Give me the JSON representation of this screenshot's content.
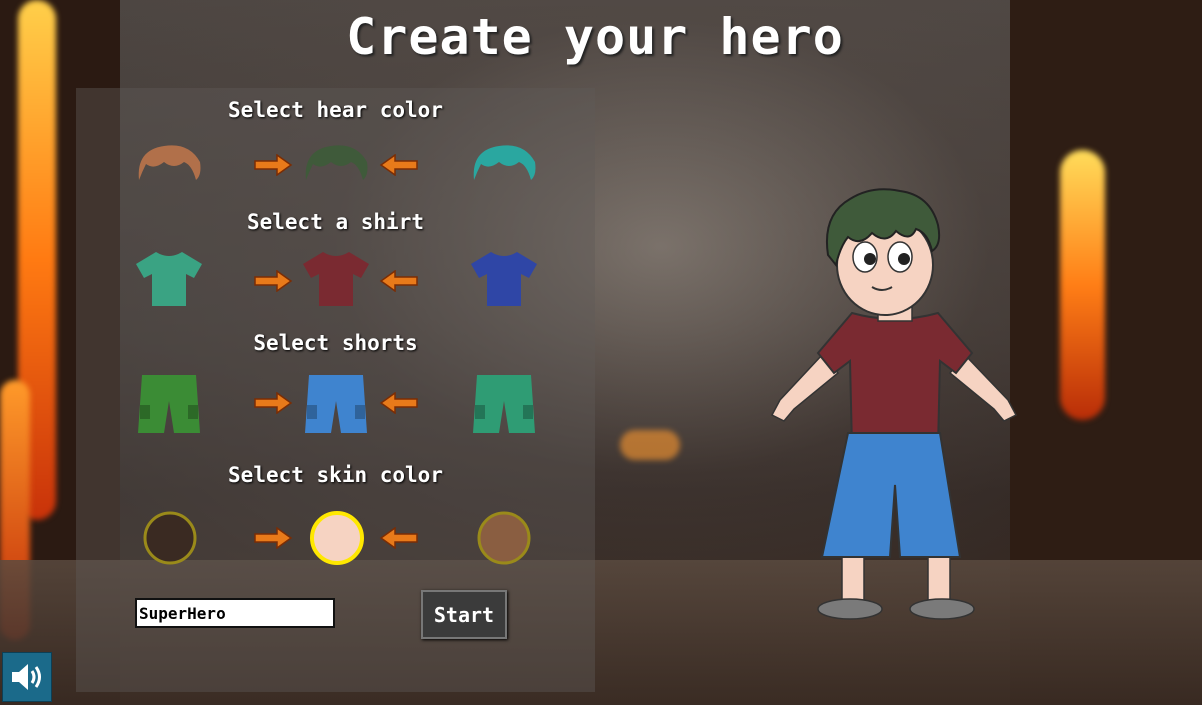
{
  "title": "Create your hero",
  "sections": {
    "hair": {
      "label": "Select hear color",
      "colors": [
        "#b1704a",
        "#3f5a3a",
        "#2aa7a0"
      ]
    },
    "shirt": {
      "label": "Select a shirt",
      "colors": [
        "#3aa383",
        "#7a2a31",
        "#2f46a6"
      ]
    },
    "shorts": {
      "label": "Select shorts",
      "colors": [
        "#3b8c35",
        "#3f84cf",
        "#2f9c74"
      ]
    },
    "skin": {
      "label": "Select skin color",
      "colors": [
        "#3a2a22",
        "#f6d3c2",
        "#8a5e41"
      ]
    }
  },
  "name_input": {
    "value": "SuperHero"
  },
  "start_button": {
    "label": "Start"
  },
  "icons": {
    "arrow_left": "arrow-left-icon",
    "arrow_right": "arrow-right-icon",
    "sound": "speaker-icon"
  },
  "colors": {
    "selected_ring": "#ffe800",
    "unselected_ring": "#9a8a1a",
    "arrow_fill": "#e87a1a"
  }
}
